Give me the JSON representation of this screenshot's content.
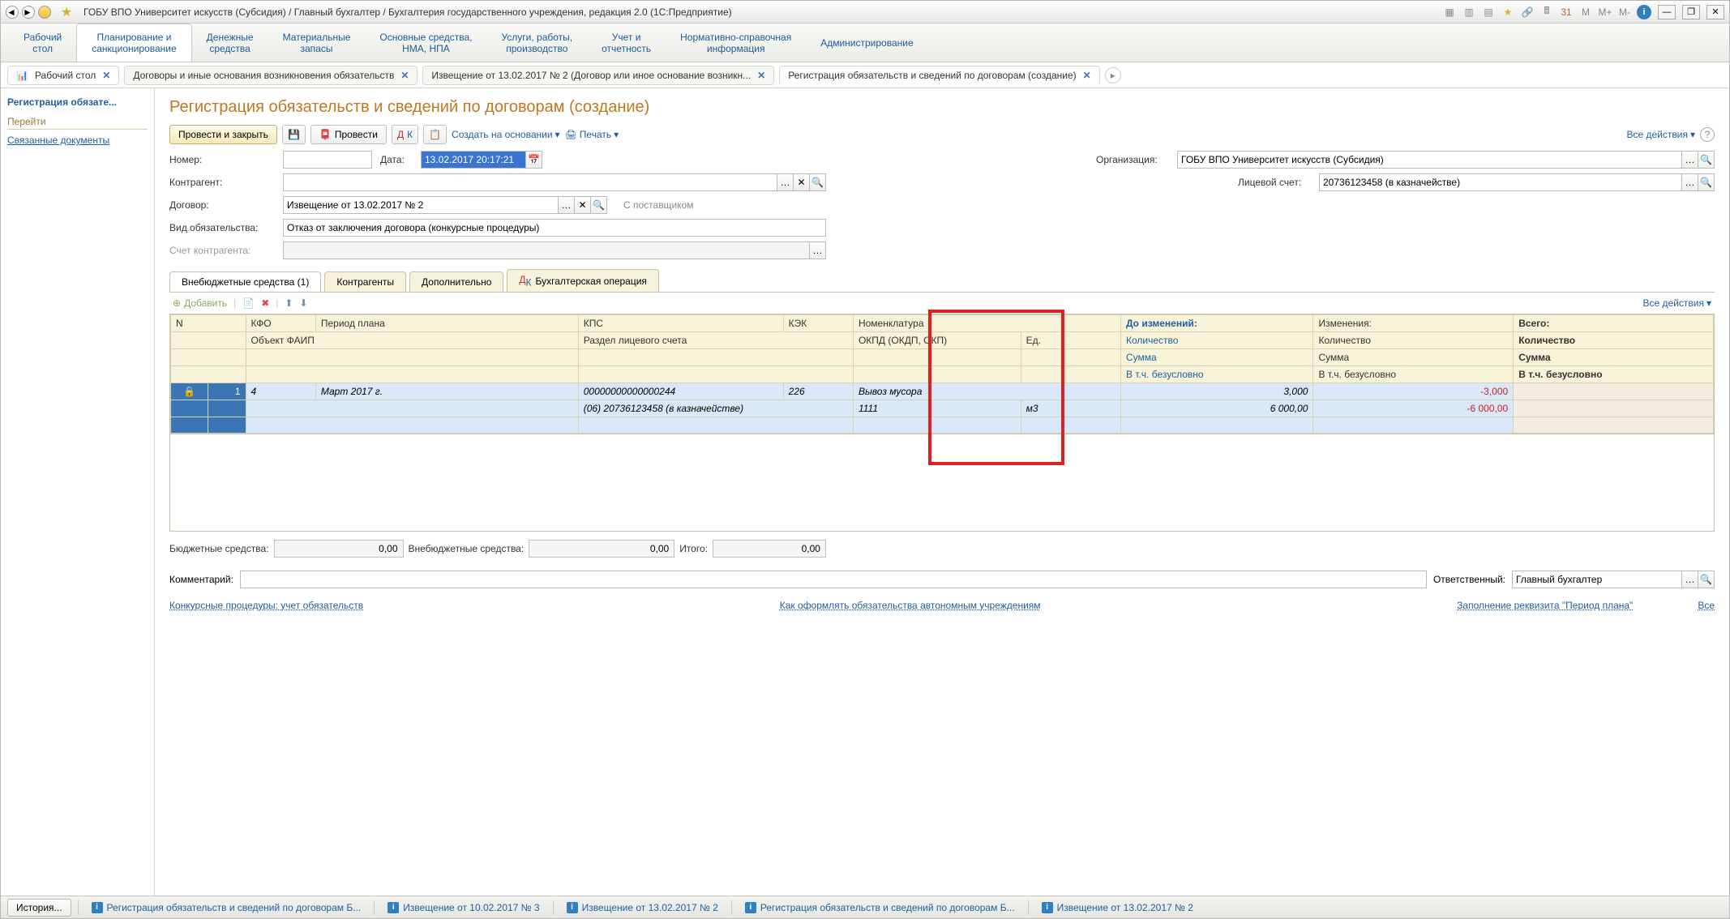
{
  "title": "ГОБУ ВПО Университет искусств (Субсидия) / Главный бухгалтер / Бухгалтерия государственного учреждения, редакция 2.0  (1С:Предприятие)",
  "title_right": {
    "m": "M",
    "mplus": "M+",
    "mminus": "M-"
  },
  "sections": [
    {
      "l1": "Рабочий",
      "l2": "стол"
    },
    {
      "l1": "Планирование и",
      "l2": "санкционирование"
    },
    {
      "l1": "Денежные",
      "l2": "средства"
    },
    {
      "l1": "Материальные",
      "l2": "запасы"
    },
    {
      "l1": "Основные средства,",
      "l2": "НМА, НПА"
    },
    {
      "l1": "Услуги, работы,",
      "l2": "производство"
    },
    {
      "l1": "Учет и",
      "l2": "отчетность"
    },
    {
      "l1": "Нормативно-справочная",
      "l2": "информация"
    },
    {
      "l1": "Администрирование",
      "l2": ""
    }
  ],
  "doc_tabs": {
    "desktop": "Рабочий стол",
    "tab1": "Договоры и иные основания возникновения обязательств",
    "tab2": "Извещение от 13.02.2017 № 2 (Договор или иное основание возникн...",
    "tab3": "Регистрация обязательств и сведений по договорам (создание)"
  },
  "left": {
    "title": "Регистрация обязате...",
    "section": "Перейти",
    "link": "Связанные документы"
  },
  "page_title": "Регистрация обязательств и сведений по договорам (создание)",
  "toolbar": {
    "save_close": "Провести и закрыть",
    "save": "Провести",
    "create_based": "Создать на основании",
    "print": "Печать",
    "all_actions": "Все действия"
  },
  "form": {
    "number_label": "Номер:",
    "date_label": "Дата:",
    "date_value": "13.02.2017 20:17:21",
    "org_label": "Организация:",
    "org_value": "ГОБУ ВПО Университет искусств (Субсидия)",
    "counterparty_label": "Контрагент:",
    "account_label": "Лицевой счет:",
    "account_value": "20736123458 (в казначействе)",
    "contract_label": "Договор:",
    "contract_value": "Извещение от 13.02.2017 № 2",
    "contract_after": "С поставщиком",
    "obligation_type_label": "Вид обязательства:",
    "obligation_type_value": "Отказ от заключения договора (конкурсные процедуры)",
    "cp_account_label": "Счет контрагента:"
  },
  "inner_tabs": {
    "tab1": "Внебюджетные средства (1)",
    "tab2": "Контрагенты",
    "tab3": "Дополнительно",
    "tab4": "Бухгалтерская операция"
  },
  "grid_toolbar": {
    "add": "Добавить",
    "all_actions": "Все действия"
  },
  "headers": {
    "n": "N",
    "kfo": "КФО",
    "period": "Период плана",
    "kps": "КПС",
    "kek": "КЭК",
    "nomen": "Номенклатура",
    "before": "До изменений:",
    "change": "Изменения:",
    "total": "Всего:",
    "faip": "Объект ФАИП",
    "section": "Раздел лицевого счета",
    "okpd": "ОКПД (ОКДП, ОКП)",
    "ed": "Ед.",
    "qty": "Количество",
    "sum": "Сумма",
    "uncond": "В т.ч. безусловно"
  },
  "row": {
    "n": "1",
    "kfo": "4",
    "period": "Март 2017 г.",
    "kps": "00000000000000244",
    "kek": "226",
    "nomen": "Вывоз мусора",
    "section": "(06) 20736123458 (в казначействе)",
    "okpd": "1111",
    "ed": "м3",
    "before_qty": "3,000",
    "before_sum": "6 000,00",
    "change_qty": "-3,000",
    "change_sum": "-6 000,00"
  },
  "totals": {
    "budget_label": "Бюджетные средства:",
    "budget_value": "0,00",
    "extra_label": "Внебюджетные средства:",
    "extra_value": "0,00",
    "total_label": "Итого:",
    "total_value": "0,00"
  },
  "comment": {
    "label": "Комментарий:",
    "resp_label": "Ответственный:",
    "resp_value": "Главный бухгалтер"
  },
  "bottom_links": {
    "l1": "Конкурсные процедуры: учет обязательств",
    "l2": "Как оформлять обязательства автономным учреждениям",
    "l3": "Заполнение реквизита \"Период плана\"",
    "all": "Все"
  },
  "taskbar": {
    "history": "История...",
    "items": [
      "Регистрация обязательств и сведений по договорам Б...",
      "Извещение от 10.02.2017 № 3",
      "Извещение от 13.02.2017 № 2",
      "Регистрация обязательств и сведений по договорам Б...",
      "Извещение от 13.02.2017 № 2"
    ]
  }
}
